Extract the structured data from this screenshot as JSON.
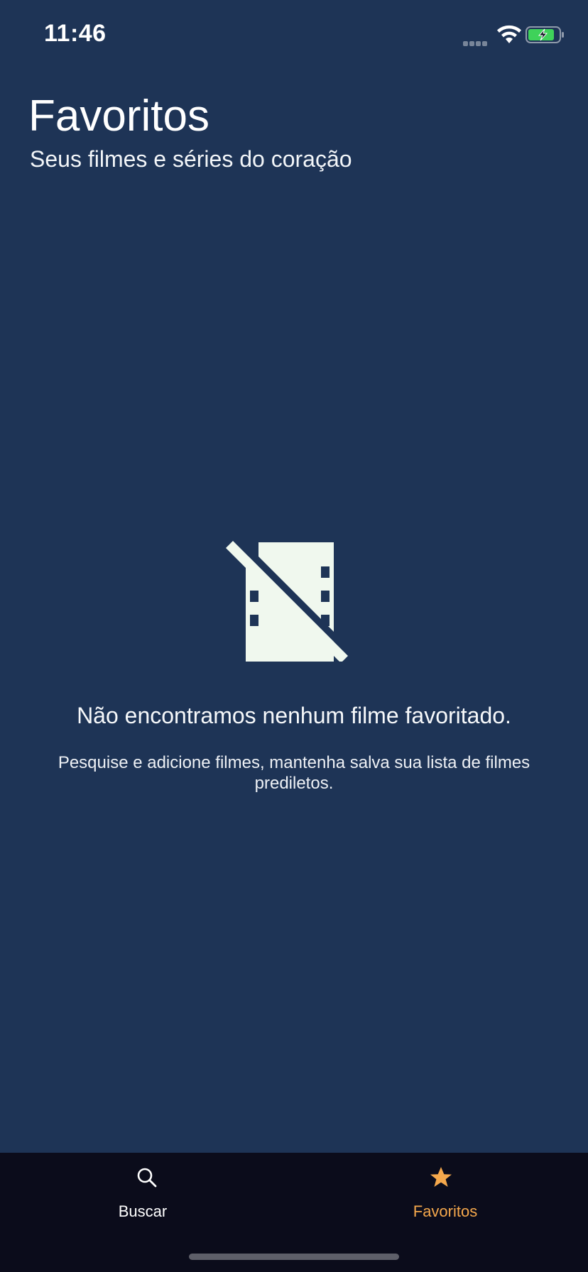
{
  "status_bar": {
    "time": "11:46"
  },
  "header": {
    "title": "Favoritos",
    "subtitle": "Seus filmes e séries do coração"
  },
  "empty_state": {
    "icon": "movie-off-icon",
    "title": "Não encontramos nenhum filme favoritado.",
    "description": "Pesquise e adicione filmes, mantenha salva sua lista de filmes prediletos."
  },
  "tab_bar": {
    "tabs": [
      {
        "label": "Buscar",
        "icon": "search-icon",
        "active": false
      },
      {
        "label": "Favoritos",
        "icon": "star-icon",
        "active": true
      }
    ]
  },
  "colors": {
    "background": "#1e3456",
    "tab_bar_background": "#0b0c1b",
    "active_tab": "#f5a84c",
    "inactive_tab": "#ffffff",
    "icon_fill": "#f0f8ee",
    "battery_green": "#3fd25a"
  }
}
